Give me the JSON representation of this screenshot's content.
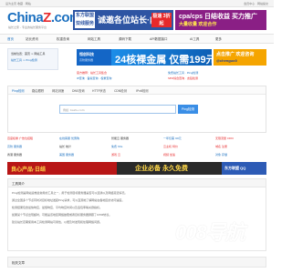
{
  "topbar": {
    "left": "设为主页 收藏 · 网站",
    "right": "会员中心 · 网站提交"
  },
  "logo": {
    "wordmark_a": "China",
    "wordmark_b": "Z",
    "wordmark_c": ".com",
    "subtitle": "站长之家 - 专业的站长服务平台"
  },
  "ads": {
    "ad1": {
      "side": "东方联盟 双线服务",
      "main": "诚邀各位站长·内存",
      "badge": "极速 3折起"
    },
    "ad2": {
      "main": "cpa/cps 日结收益 买力推广",
      "sub": "大量收量 欢迎合作"
    },
    "ad4": {
      "main": "恒创科技",
      "sub": "高防服务器"
    },
    "ad5": {
      "main": "24核裸金属 仅需199元"
    },
    "ad6": {
      "main": "点击推广 欢迎咨询",
      "sub": "@chenguo0"
    },
    "ad7": {
      "left": "良心产品·日结",
      "mid": "企业必备 永久免费",
      "right": "东方联盟 QQ"
    }
  },
  "nav": {
    "items": [
      "首页",
      "站长资讯",
      "权重查询",
      "网站工具",
      "源码下载",
      "API数据接口",
      "AI工具",
      "更多"
    ]
  },
  "breadcrumb": {
    "line1": "当前位置：首页 > 网站工具",
    "line2": "站长工具 > Ping检测"
  },
  "notices": [
    "官方推荐：站长工具集合",
    "免费站长工具 · Ping检测",
    "IP查询 · 备案查询 · 权重查询",
    "SEO综合查询 · 友链检测"
  ],
  "tabs": [
    "Ping检测",
    "路由跟踪",
    "网站测速",
    "DNS查询",
    "HTTP状态",
    "CDN检测",
    "IPv6检测"
  ],
  "search": {
    "placeholder": "例如: baidu.com",
    "button": "Ping检测"
  },
  "grid": [
    [
      "百度权重 广告位招租",
      "在线客服 优惠购",
      "智能云 服务器",
      "一年仅需 99元",
      "无限流量 CDN"
    ],
    [
      "高防 服务器",
      "站长 统计",
      "免费 SSL",
      "云主机 特价",
      "域名 注册"
    ],
    [
      "香港 服务器",
      "美国 服务器",
      "游戏 云",
      "视频 加速",
      "对象 存储"
    ]
  ],
  "intro": {
    "title": "工具简介",
    "lines": [
      "Ping检测是网站运维最常用的工具之一，用于检测目标服务器是否可以连通以及网络延迟情况。",
      "通过全国多个节点同时对目标地址发起Ping请求，可以直观地了解网站在各地区的访问速度。",
      "检测结果包含最快响应、最慢响应、平均响应时间以及丢包率等关键指标。",
      "如果某个节点出现超时，可能是该地区网络故障或者目标服务器屏蔽了ICMP协议。",
      "建议站长定期使用本工具检测网站可用性，以便及时发现和处理网络问题。"
    ]
  },
  "watermark": "008导航",
  "bottom": {
    "title": "相关文章"
  },
  "colors": {
    "brand": "#1a6fbf",
    "accent": "#e7292b",
    "button": "#3a8ee6"
  }
}
